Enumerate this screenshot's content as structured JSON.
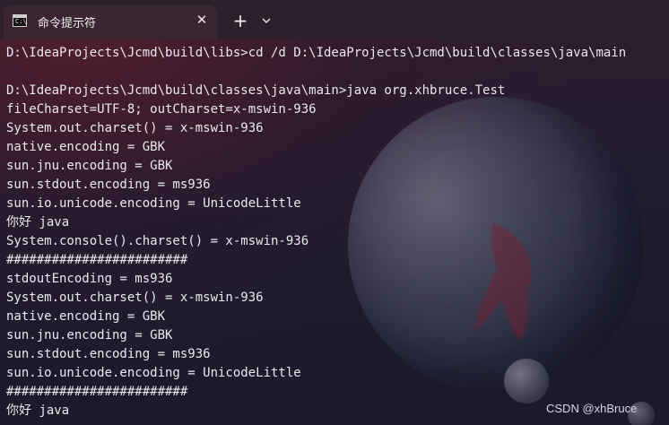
{
  "tab": {
    "icon": "terminal-icon",
    "icon_text": "C:\\",
    "title": "命令提示符",
    "close_label": "✕"
  },
  "toolbar": {
    "new_tab_label": "+",
    "dropdown_icon": "chevron-down-icon"
  },
  "terminal": {
    "lines": [
      "D:\\IdeaProjects\\Jcmd\\build\\libs>cd /d D:\\IdeaProjects\\Jcmd\\build\\classes\\java\\main",
      "",
      "D:\\IdeaProjects\\Jcmd\\build\\classes\\java\\main>java org.xhbruce.Test",
      "fileCharset=UTF-8; outCharset=x-mswin-936",
      "System.out.charset() = x-mswin-936",
      "native.encoding = GBK",
      "sun.jnu.encoding = GBK",
      "sun.stdout.encoding = ms936",
      "sun.io.unicode.encoding = UnicodeLittle",
      "你好 java",
      "System.console().charset() = x-mswin-936",
      "########################",
      "stdoutEncoding = ms936",
      "System.out.charset() = x-mswin-936",
      "native.encoding = GBK",
      "sun.jnu.encoding = GBK",
      "sun.stdout.encoding = ms936",
      "sun.io.unicode.encoding = UnicodeLittle",
      "########################",
      "你好 java"
    ]
  },
  "watermark": "CSDN @xhBruce",
  "colors": {
    "text": "#e9e9ee",
    "tab_active": "#3a2630",
    "tabbar": "#2a1f2b"
  }
}
